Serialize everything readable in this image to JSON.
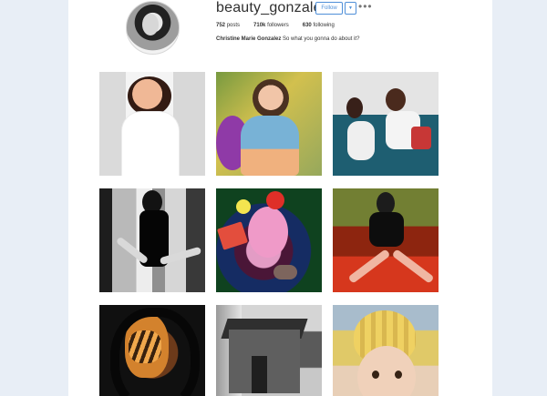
{
  "profile": {
    "username": "beauty_gonzalez",
    "follow_label": "Follow",
    "dropdown_label": "▼",
    "more_label": "•••",
    "posts_count": "752",
    "posts_label": "posts",
    "followers_count": "710k",
    "followers_label": "followers",
    "following_count": "630",
    "following_label": "following",
    "bio_name": "Christine Marie Gonzalez",
    "bio_text": "So what you gonna do about it?"
  },
  "colors": {
    "page_background": "#e8eef6",
    "content_background": "#ffffff",
    "accent": "#4f8fd8"
  }
}
